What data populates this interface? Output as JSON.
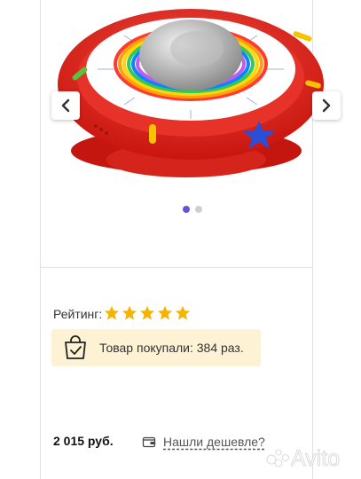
{
  "gallery": {
    "image_alt": "Red toy with alphabet wheel",
    "prev_icon": "chevron-left-icon",
    "next_icon": "chevron-right-icon",
    "slides_total": 2,
    "active_slide": 1
  },
  "rating": {
    "label": "Рейтинг:",
    "stars": 5,
    "max_stars": 5,
    "star_color": "#f6b400"
  },
  "purchases": {
    "text": "Товар покупали: 384 раз.",
    "icon": "shopping-bag-check-icon",
    "background": "#fdf2d4"
  },
  "offer": {
    "price": "2 015 руб.",
    "cheaper_link": "Нашли дешевле?",
    "cheaper_icon": "wallet-icon"
  },
  "watermark": {
    "text": "Avito"
  },
  "colors": {
    "accent": "#6a4fd8",
    "toy_red": "#e1241b"
  }
}
